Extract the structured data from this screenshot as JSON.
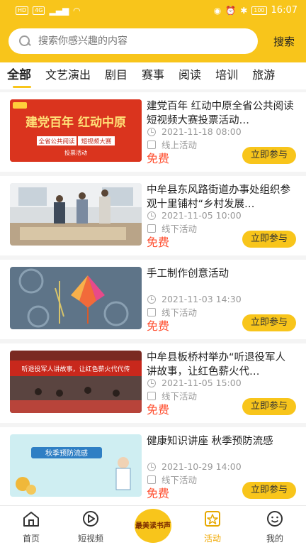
{
  "status": {
    "left": [
      "HD",
      "4G"
    ],
    "battery": "100",
    "time": "16:07"
  },
  "search": {
    "placeholder": "搜索你感兴趣的内容",
    "button": "搜索"
  },
  "tabs": [
    "全部",
    "文艺演出",
    "剧目",
    "赛事",
    "阅读",
    "培训",
    "旅游"
  ],
  "activities": [
    {
      "title": "建党百年 红动中原全省公共阅读短视频大赛投票活动…",
      "date": "2021-11-18 08:00",
      "mode": "线上活动",
      "price": "免费",
      "action": "立即参与"
    },
    {
      "title": "中牟县东风路街道办事处组织参观十里铺村“乡村发展…",
      "date": "2021-11-05 10:00",
      "mode": "线下活动",
      "price": "免费",
      "action": "立即参与"
    },
    {
      "title": "手工制作创意活动",
      "date": "2021-11-03 14:30",
      "mode": "线下活动",
      "price": "免费",
      "action": "立即参与"
    },
    {
      "title": "中牟县板桥村举办“听退役军人讲故事，让红色薪火代…",
      "date": "2021-11-05 15:00",
      "mode": "线下活动",
      "price": "免费",
      "action": "立即参与"
    },
    {
      "title": "健康知识讲座 秋季预防流感",
      "date": "2021-10-29 14:00",
      "mode": "线下活动",
      "price": "免费",
      "action": "立即参与"
    }
  ],
  "thumbs": {
    "t1_main": "建党百年 红动中原",
    "t1_sub": "全省公共阅读",
    "t1_sub2": "短视频大赛",
    "t1_foot": "投票活动",
    "t4_banner": "听退役军人讲故事，让红色薪火代代传",
    "t5_title": "秋季预防流感"
  },
  "nav": {
    "home": "首页",
    "video": "短视频",
    "logo": "最美读书声",
    "activity": "活动",
    "mine": "我的"
  },
  "colors": {
    "accent": "#f8c51b",
    "price": "#ff4d2e"
  }
}
